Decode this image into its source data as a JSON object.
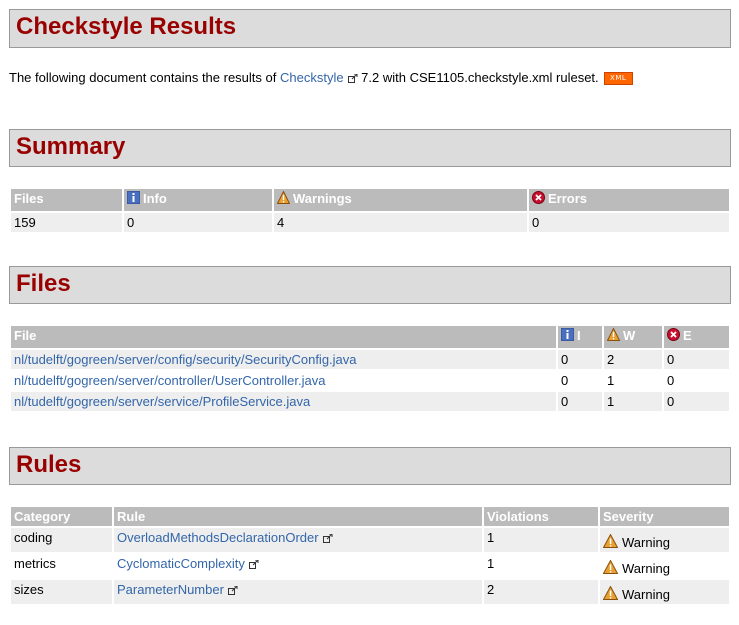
{
  "page": {
    "title": "Checkstyle Results"
  },
  "intro": {
    "prefix": "The following document contains the results of ",
    "link": "Checkstyle",
    "suffix": " 7.2 with CSE1105.checkstyle.xml ruleset.",
    "xml_badge": "XML"
  },
  "summary": {
    "heading": "Summary",
    "headers": {
      "files": "Files",
      "info": "Info",
      "warnings": "Warnings",
      "errors": "Errors"
    },
    "row": {
      "files": "159",
      "info": "0",
      "warnings": "4",
      "errors": "0"
    }
  },
  "files": {
    "heading": "Files",
    "headers": {
      "file": "File",
      "i": "I",
      "w": "W",
      "e": "E"
    },
    "rows": [
      {
        "file": "nl/tudelft/gogreen/server/config/security/SecurityConfig.java",
        "i": "0",
        "w": "2",
        "e": "0"
      },
      {
        "file": "nl/tudelft/gogreen/server/controller/UserController.java",
        "i": "0",
        "w": "1",
        "e": "0"
      },
      {
        "file": "nl/tudelft/gogreen/server/service/ProfileService.java",
        "i": "0",
        "w": "1",
        "e": "0"
      }
    ]
  },
  "rules": {
    "heading": "Rules",
    "headers": {
      "category": "Category",
      "rule": "Rule",
      "violations": "Violations",
      "severity": "Severity"
    },
    "rows": [
      {
        "category": "coding",
        "rule": "OverloadMethodsDeclarationOrder",
        "violations": "1",
        "severity": "Warning"
      },
      {
        "category": "metrics",
        "rule": "CyclomaticComplexity",
        "violations": "1",
        "severity": "Warning"
      },
      {
        "category": "sizes",
        "rule": "ParameterNumber",
        "violations": "2",
        "severity": "Warning"
      }
    ]
  },
  "colors": {
    "heading": "#990000",
    "link": "#3366aa",
    "header_bg": "#bbbbbb",
    "section_bg": "#dcdcdc"
  },
  "icons": {
    "info": "info-icon",
    "warning": "warning-icon",
    "error": "error-icon",
    "external": "external-link-icon"
  }
}
